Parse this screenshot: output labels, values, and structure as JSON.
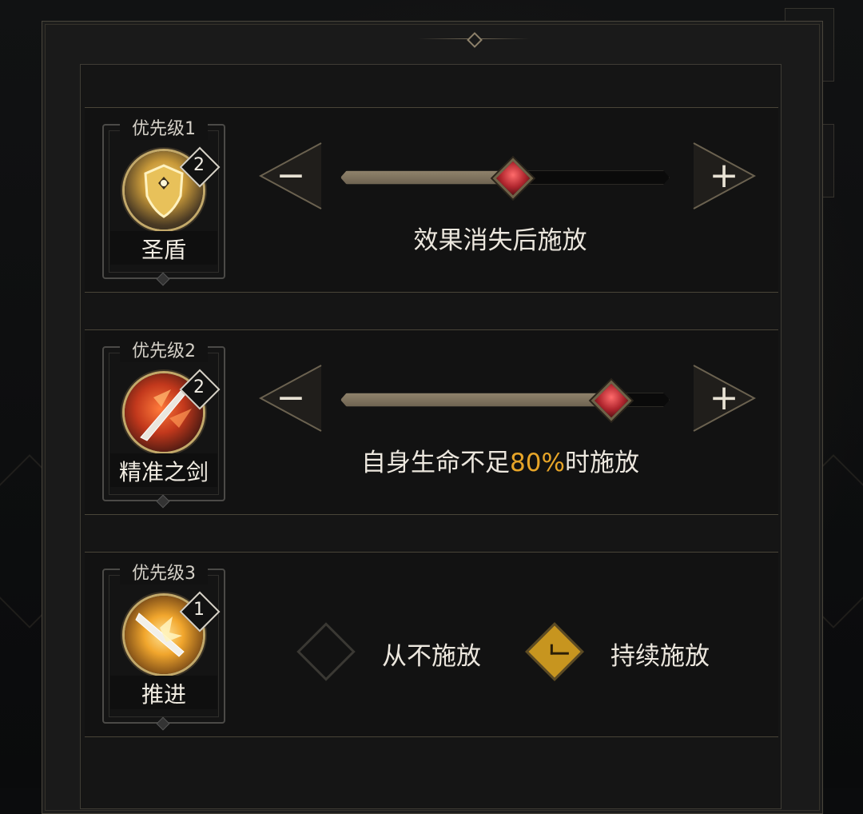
{
  "theme": {
    "accent": "#e7a528",
    "check": "#c7951f"
  },
  "skills": [
    {
      "priority_label": "优先级1",
      "level": "2",
      "name": "圣盾",
      "icon": "holy-shield-icon",
      "mode": "slider",
      "slider_fraction": 0.52,
      "condition_text": "效果消失后施放"
    },
    {
      "priority_label": "优先级2",
      "level": "2",
      "name": "精准之剑",
      "icon": "precise-sword-icon",
      "mode": "slider",
      "slider_fraction": 0.82,
      "condition_prefix": "自身生命不足",
      "condition_value": "80%",
      "condition_suffix": "时施放"
    },
    {
      "priority_label": "优先级3",
      "level": "1",
      "name": "推进",
      "icon": "advance-icon",
      "mode": "options",
      "options": [
        {
          "label": "从不施放",
          "checked": false
        },
        {
          "label": "持续施放",
          "checked": true
        }
      ]
    }
  ],
  "controls": {
    "minus": "−",
    "plus": "+"
  }
}
